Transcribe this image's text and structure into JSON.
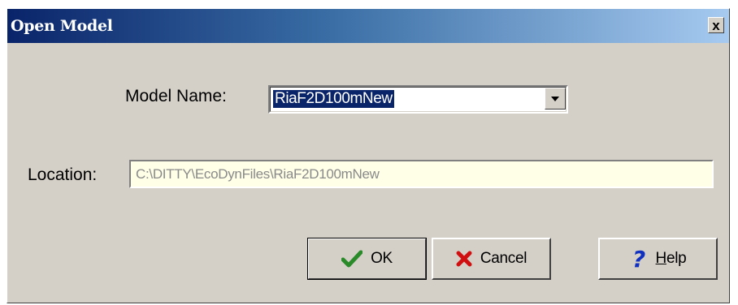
{
  "window": {
    "title": "Open Model",
    "close_label": "x"
  },
  "form": {
    "model_name_label": "Model Name:",
    "model_name_value": "RiaF2D100mNew",
    "location_label": "Location:",
    "location_value": "C:\\DITTY\\EcoDynFiles\\RiaF2D100mNew"
  },
  "buttons": {
    "ok_label": "OK",
    "cancel_label": "Cancel",
    "help_label_underlined": "H",
    "help_label_rest": "elp"
  },
  "icons": {
    "ok": "checkmark-icon",
    "cancel": "red-x-icon",
    "help": "question-mark-icon",
    "dropdown": "chevron-down-icon"
  },
  "colors": {
    "title_start": "#0a246a",
    "title_end": "#a6caf0",
    "selection": "#0a246a",
    "ok_check": "#2a8a2a",
    "cancel_x": "#d01010",
    "help_q": "#1030c0"
  }
}
